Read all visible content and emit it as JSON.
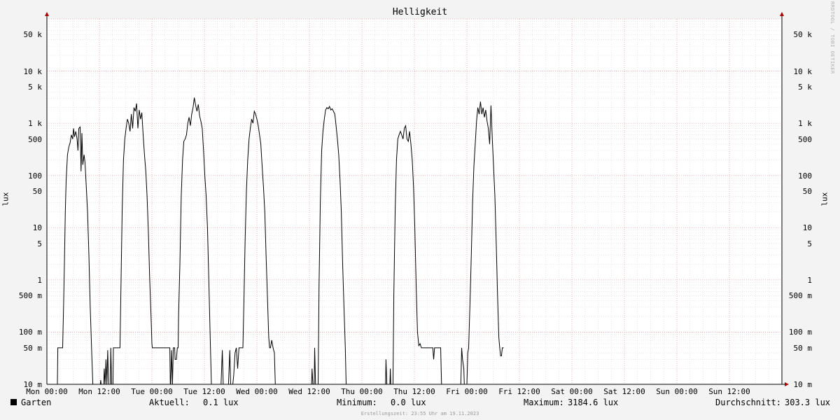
{
  "colors": {
    "background": "#f3f3f3",
    "plot": "#ffffff",
    "major_grid": "#e8a0a0",
    "minor_grid": "#d8d8d8",
    "line": "#000000",
    "arrow": "#aa0000"
  },
  "watermark": "RRDTOOL / TOBI OETIKER",
  "legend": {
    "series_name": "Garten",
    "current_label": "Aktuell:",
    "current_value": "0.1 lux",
    "min_label": "Minimum:",
    "min_value": "0.0 lux",
    "max_label": "Maximum:",
    "max_value": "3184.6 lux",
    "avg_label": "Durchschnitt:",
    "avg_value": "303.3 lux"
  },
  "footer": "Erstellungszeit: 23:55 Uhr am 19.11.2023",
  "chart_data": {
    "type": "line",
    "title": "Helligkeit",
    "ylabel": "lux",
    "xlabel": "",
    "y_scale": "log",
    "ylim": [
      0.01,
      100000
    ],
    "xlim": [
      0,
      168
    ],
    "grid": true,
    "legend_position": "bottom",
    "y_ticks": [
      {
        "v": 0.01,
        "label": "10 m"
      },
      {
        "v": 0.05,
        "label": "50 m"
      },
      {
        "v": 0.1,
        "label": "100 m"
      },
      {
        "v": 0.5,
        "label": "500 m"
      },
      {
        "v": 1,
        "label": "1"
      },
      {
        "v": 5,
        "label": "5"
      },
      {
        "v": 10,
        "label": "10"
      },
      {
        "v": 50,
        "label": "50"
      },
      {
        "v": 100,
        "label": "100"
      },
      {
        "v": 500,
        "label": "500"
      },
      {
        "v": 1000,
        "label": "1 k"
      },
      {
        "v": 5000,
        "label": "5 k"
      },
      {
        "v": 10000,
        "label": "10 k"
      },
      {
        "v": 50000,
        "label": "50 k"
      }
    ],
    "x_ticks": [
      {
        "h": 0,
        "label": "Mon 00:00"
      },
      {
        "h": 12,
        "label": "Mon 12:00"
      },
      {
        "h": 24,
        "label": "Tue 00:00"
      },
      {
        "h": 36,
        "label": "Tue 12:00"
      },
      {
        "h": 48,
        "label": "Wed 00:00"
      },
      {
        "h": 60,
        "label": "Wed 12:00"
      },
      {
        "h": 72,
        "label": "Thu 00:00"
      },
      {
        "h": 84,
        "label": "Thu 12:00"
      },
      {
        "h": 96,
        "label": "Fri 00:00"
      },
      {
        "h": 108,
        "label": "Fri 12:00"
      },
      {
        "h": 120,
        "label": "Sat 00:00"
      },
      {
        "h": 132,
        "label": "Sat 12:00"
      },
      {
        "h": 144,
        "label": "Sun 00:00"
      },
      {
        "h": 156,
        "label": "Sun 12:00"
      }
    ],
    "series": [
      {
        "name": "Garten",
        "points": [
          [
            2.4,
            0.005
          ],
          [
            2.5,
            0.05
          ],
          [
            3.5,
            0.05
          ],
          [
            3.6,
            0.05
          ],
          [
            3.8,
            0.3
          ],
          [
            4.0,
            2
          ],
          [
            4.2,
            20
          ],
          [
            4.4,
            80
          ],
          [
            4.7,
            250
          ],
          [
            5.0,
            350
          ],
          [
            5.3,
            420
          ],
          [
            5.6,
            600
          ],
          [
            5.9,
            500
          ],
          [
            6.1,
            800
          ],
          [
            6.3,
            550
          ],
          [
            6.6,
            700
          ],
          [
            6.9,
            500
          ],
          [
            7.1,
            300
          ],
          [
            7.3,
            800
          ],
          [
            7.6,
            850
          ],
          [
            7.8,
            120
          ],
          [
            8.0,
            650
          ],
          [
            8.2,
            160
          ],
          [
            8.5,
            250
          ],
          [
            8.7,
            180
          ],
          [
            9.0,
            60
          ],
          [
            9.3,
            20
          ],
          [
            9.6,
            3
          ],
          [
            9.9,
            0.3
          ],
          [
            10.2,
            0.05
          ],
          [
            10.5,
            0.01
          ],
          [
            10.7,
            0.005
          ],
          [
            11.2,
            0.005
          ],
          [
            11.3,
            0.01
          ],
          [
            11.4,
            0.005
          ],
          [
            12.2,
            0.005
          ],
          [
            12.3,
            0.012
          ],
          [
            12.4,
            0.005
          ],
          [
            13.0,
            0.005
          ],
          [
            13.1,
            0.02
          ],
          [
            13.3,
            0.005
          ],
          [
            13.5,
            0.03
          ],
          [
            13.7,
            0.005
          ],
          [
            13.9,
            0.045
          ],
          [
            14.1,
            0.005
          ],
          [
            14.5,
            0.005
          ],
          [
            14.6,
            0.05
          ],
          [
            14.8,
            0.005
          ],
          [
            15.1,
            0.005
          ],
          [
            15.2,
            0.05
          ],
          [
            15.3,
            0.05
          ],
          [
            16.7,
            0.05
          ],
          [
            16.9,
            0.5
          ],
          [
            17.2,
            20
          ],
          [
            17.5,
            200
          ],
          [
            17.8,
            500
          ],
          [
            18.1,
            800
          ],
          [
            18.4,
            1200
          ],
          [
            18.7,
            1000
          ],
          [
            19.0,
            700
          ],
          [
            19.3,
            1500
          ],
          [
            19.6,
            800
          ],
          [
            19.9,
            2000
          ],
          [
            20.2,
            1700
          ],
          [
            20.5,
            2400
          ],
          [
            20.8,
            800
          ],
          [
            21.1,
            1800
          ],
          [
            21.4,
            1200
          ],
          [
            21.7,
            1600
          ],
          [
            22.0,
            600
          ],
          [
            22.3,
            250
          ],
          [
            22.6,
            120
          ],
          [
            22.9,
            40
          ],
          [
            23.2,
            8
          ],
          [
            23.5,
            1
          ],
          [
            23.8,
            0.2
          ],
          [
            24.0,
            0.06
          ],
          [
            24.1,
            0.05
          ],
          [
            28.0,
            0.05
          ],
          [
            28.1,
            0.05
          ],
          [
            28.2,
            0.01
          ],
          [
            28.3,
            0.003
          ],
          [
            28.5,
            0.045
          ],
          [
            28.7,
            0.005
          ],
          [
            28.9,
            0.05
          ],
          [
            29.2,
            0.05
          ],
          [
            29.3,
            0.03
          ],
          [
            29.6,
            0.03
          ],
          [
            29.8,
            0.05
          ],
          [
            30.0,
            0.05
          ],
          [
            30.1,
            0.2
          ],
          [
            30.4,
            2
          ],
          [
            30.7,
            40
          ],
          [
            31.0,
            200
          ],
          [
            31.3,
            450
          ],
          [
            31.6,
            500
          ],
          [
            31.9,
            600
          ],
          [
            32.2,
            1000
          ],
          [
            32.5,
            1300
          ],
          [
            32.8,
            900
          ],
          [
            33.1,
            1500
          ],
          [
            33.4,
            2000
          ],
          [
            33.7,
            3100
          ],
          [
            34.0,
            2200
          ],
          [
            34.3,
            1700
          ],
          [
            34.6,
            2300
          ],
          [
            34.9,
            1400
          ],
          [
            35.2,
            1100
          ],
          [
            35.5,
            800
          ],
          [
            35.8,
            300
          ],
          [
            36.1,
            100
          ],
          [
            36.4,
            40
          ],
          [
            36.7,
            10
          ],
          [
            37.0,
            1
          ],
          [
            37.3,
            0.1
          ],
          [
            37.6,
            0.01
          ],
          [
            37.8,
            0.005
          ],
          [
            39.8,
            0.005
          ],
          [
            40.1,
            0.045
          ],
          [
            40.3,
            0.005
          ],
          [
            41.5,
            0.005
          ],
          [
            41.8,
            0.045
          ],
          [
            42.0,
            0.005
          ],
          [
            42.5,
            0.005
          ],
          [
            42.7,
            0.015
          ],
          [
            43.0,
            0.04
          ],
          [
            43.3,
            0.05
          ],
          [
            43.6,
            0.02
          ],
          [
            43.9,
            0.05
          ],
          [
            44.2,
            0.05
          ],
          [
            44.6,
            0.05
          ],
          [
            44.8,
            0.05
          ],
          [
            45.0,
            0.3
          ],
          [
            45.3,
            5
          ],
          [
            45.6,
            50
          ],
          [
            45.9,
            200
          ],
          [
            46.2,
            500
          ],
          [
            46.5,
            800
          ],
          [
            46.8,
            1200
          ],
          [
            47.1,
            1000
          ],
          [
            47.4,
            1700
          ],
          [
            47.7,
            1500
          ],
          [
            48.0,
            1200
          ],
          [
            48.3,
            900
          ],
          [
            48.6,
            600
          ],
          [
            48.9,
            400
          ],
          [
            49.2,
            150
          ],
          [
            49.5,
            60
          ],
          [
            49.8,
            20
          ],
          [
            50.1,
            3
          ],
          [
            50.4,
            0.5
          ],
          [
            50.7,
            0.08
          ],
          [
            50.9,
            0.05
          ],
          [
            51.1,
            0.05
          ],
          [
            51.4,
            0.07
          ],
          [
            51.7,
            0.05
          ],
          [
            52.0,
            0.04
          ],
          [
            52.2,
            0.005
          ],
          [
            60.5,
            0.005
          ],
          [
            60.6,
            0.02
          ],
          [
            60.8,
            0.005
          ],
          [
            61.1,
            0.005
          ],
          [
            61.2,
            0.05
          ],
          [
            61.4,
            0.01
          ],
          [
            61.7,
            0.005
          ],
          [
            62.0,
            0.005
          ],
          [
            62.2,
            0.8
          ],
          [
            62.5,
            30
          ],
          [
            62.8,
            300
          ],
          [
            63.1,
            700
          ],
          [
            63.4,
            1200
          ],
          [
            63.7,
            1800
          ],
          [
            64.0,
            2000
          ],
          [
            64.3,
            1900
          ],
          [
            64.6,
            2100
          ],
          [
            64.9,
            1800
          ],
          [
            65.2,
            1900
          ],
          [
            65.5,
            1700
          ],
          [
            65.8,
            1500
          ],
          [
            66.1,
            900
          ],
          [
            66.4,
            500
          ],
          [
            66.7,
            250
          ],
          [
            67.0,
            80
          ],
          [
            67.3,
            20
          ],
          [
            67.6,
            2
          ],
          [
            67.9,
            0.3
          ],
          [
            68.2,
            0.05
          ],
          [
            68.4,
            0.01
          ],
          [
            68.5,
            0.005
          ],
          [
            77.4,
            0.005
          ],
          [
            77.5,
            0.03
          ],
          [
            77.7,
            0.005
          ],
          [
            78.4,
            0.005
          ],
          [
            78.5,
            0.02
          ],
          [
            78.6,
            0.005
          ],
          [
            79.1,
            0.005
          ],
          [
            79.3,
            0.5
          ],
          [
            79.6,
            20
          ],
          [
            79.9,
            200
          ],
          [
            80.2,
            500
          ],
          [
            80.5,
            600
          ],
          [
            80.8,
            700
          ],
          [
            81.1,
            600
          ],
          [
            81.4,
            500
          ],
          [
            81.7,
            800
          ],
          [
            82.0,
            900
          ],
          [
            82.3,
            500
          ],
          [
            82.6,
            450
          ],
          [
            82.9,
            700
          ],
          [
            83.2,
            400
          ],
          [
            83.5,
            200
          ],
          [
            83.8,
            60
          ],
          [
            84.1,
            10
          ],
          [
            84.4,
            0.8
          ],
          [
            84.7,
            0.1
          ],
          [
            85.0,
            0.055
          ],
          [
            85.3,
            0.06
          ],
          [
            85.6,
            0.05
          ],
          [
            87.8,
            0.05
          ],
          [
            88.1,
            0.05
          ],
          [
            88.2,
            0.05
          ],
          [
            88.4,
            0.03
          ],
          [
            88.6,
            0.05
          ],
          [
            90.0,
            0.05
          ],
          [
            90.2,
            0.005
          ],
          [
            94.4,
            0.005
          ],
          [
            94.6,
            0.01
          ],
          [
            94.7,
            0.02
          ],
          [
            94.8,
            0.05
          ],
          [
            95.0,
            0.03
          ],
          [
            95.3,
            0.02
          ],
          [
            95.4,
            0.005
          ],
          [
            95.8,
            0.005
          ],
          [
            96.0,
            0.01
          ],
          [
            96.2,
            0.04
          ],
          [
            96.4,
            0.05
          ],
          [
            96.7,
            0.35
          ],
          [
            97.0,
            3
          ],
          [
            97.3,
            30
          ],
          [
            97.6,
            150
          ],
          [
            97.9,
            400
          ],
          [
            98.2,
            1100
          ],
          [
            98.5,
            2000
          ],
          [
            98.8,
            1500
          ],
          [
            99.1,
            2600
          ],
          [
            99.4,
            1500
          ],
          [
            99.7,
            2000
          ],
          [
            100.0,
            1300
          ],
          [
            100.3,
            1800
          ],
          [
            100.6,
            1100
          ],
          [
            100.9,
            800
          ],
          [
            101.2,
            400
          ],
          [
            101.5,
            2200
          ],
          [
            101.8,
            500
          ],
          [
            102.1,
            150
          ],
          [
            102.4,
            40
          ],
          [
            102.7,
            5
          ],
          [
            103.0,
            0.5
          ],
          [
            103.3,
            0.08
          ],
          [
            103.5,
            0.05
          ],
          [
            103.7,
            0.035
          ],
          [
            103.9,
            0.035
          ],
          [
            104.1,
            0.05
          ],
          [
            104.4,
            0.05
          ]
        ]
      }
    ]
  }
}
